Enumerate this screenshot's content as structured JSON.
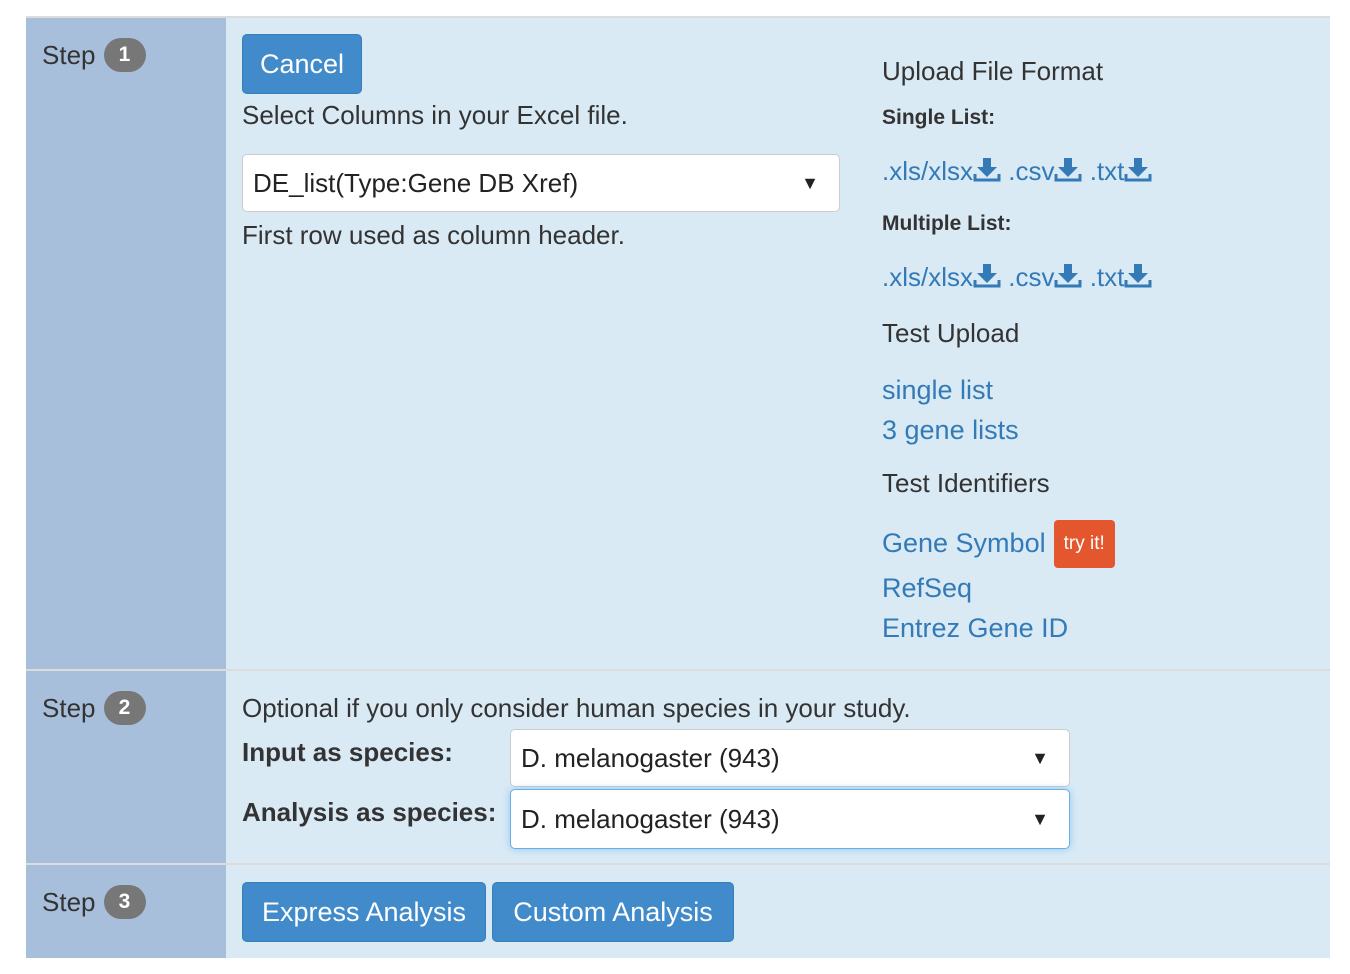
{
  "step_label": "Step",
  "steps": [
    {
      "number": "1"
    },
    {
      "number": "2"
    },
    {
      "number": "3"
    }
  ],
  "step1": {
    "cancel_label": "Cancel",
    "instruction": "Select Columns in your Excel file.",
    "column_select_value": "DE_list(Type:Gene DB Xref)",
    "header_note": "First row used as column header."
  },
  "sidebar": {
    "upload_format_title": "Upload File Format",
    "single_list_label": "Single List:",
    "multiple_list_label": "Multiple List:",
    "formats": [
      ".xls/xlsx",
      ".csv",
      ".txt"
    ],
    "test_upload_title": "Test Upload",
    "test_upload_links": [
      "single list",
      "3 gene lists"
    ],
    "test_identifiers_title": "Test Identifiers",
    "identifier_links": [
      "Gene Symbol",
      "RefSeq",
      "Entrez Gene ID"
    ],
    "try_it_badge": "try it!"
  },
  "step2": {
    "note": "Optional if you only consider human species in your study.",
    "input_species_label": "Input as species:",
    "input_species_value": "D. melanogaster (943)",
    "analysis_species_label": "Analysis as species:",
    "analysis_species_value": "D. melanogaster (943)"
  },
  "step3": {
    "express_label": "Express Analysis",
    "custom_label": "Custom Analysis"
  },
  "colors": {
    "primary": "#428bca",
    "link": "#337ab7",
    "badge": "#777777",
    "try_it": "#e4572e"
  }
}
